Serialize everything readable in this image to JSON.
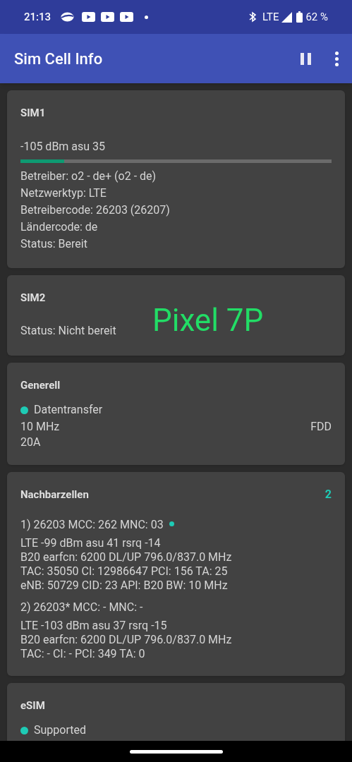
{
  "status_bar": {
    "time": "21:13",
    "network": "LTE",
    "battery": "62 %"
  },
  "app_bar": {
    "title": "Sim Cell Info"
  },
  "sim1": {
    "title": "SIM1",
    "signal": "-105 dBm asu 35",
    "level": 0.14,
    "lines": [
      "Betreiber: o2 - de+ (o2 - de)",
      "Netzwerktyp: LTE",
      "Betreibercode: 26203 (26207)",
      "Ländercode: de",
      "Status: Bereit"
    ]
  },
  "sim2": {
    "title": "SIM2",
    "status": "Status: Nicht bereit",
    "overlay": "Pixel 7P"
  },
  "general": {
    "title": "Generell",
    "indicator": {
      "label": "Datentransfer",
      "color": "#1ecbb5"
    },
    "bandwidth": "10 MHz",
    "duplex": "FDD",
    "band": "20A"
  },
  "neighbors": {
    "title": "Nachbarzellen",
    "count": "2",
    "cells": [
      {
        "header": "1) 26203 MCC: 262 MNC: 03",
        "active": true,
        "lines": [
          "LTE -99 dBm asu 41 rsrq -14",
          "B20 earfcn: 6200 DL/UP 796.0/837.0 MHz",
          "TAC: 35050 CI: 12986647 PCI: 156 TA: 25",
          "eNB: 50729 CID: 23 API: B20 BW: 10 MHz"
        ]
      },
      {
        "header": "2) 26203* MCC: - MNC: -",
        "active": false,
        "lines": [
          "LTE -103 dBm asu 37 rsrq -15",
          "B20 earfcn: 6200 DL/UP 796.0/837.0 MHz",
          "TAC: - CI: - PCI: 349 TA: 0"
        ]
      }
    ]
  },
  "esim": {
    "title": "eSIM",
    "indicator": {
      "label": "Supported",
      "color": "#1ecbb5"
    }
  }
}
